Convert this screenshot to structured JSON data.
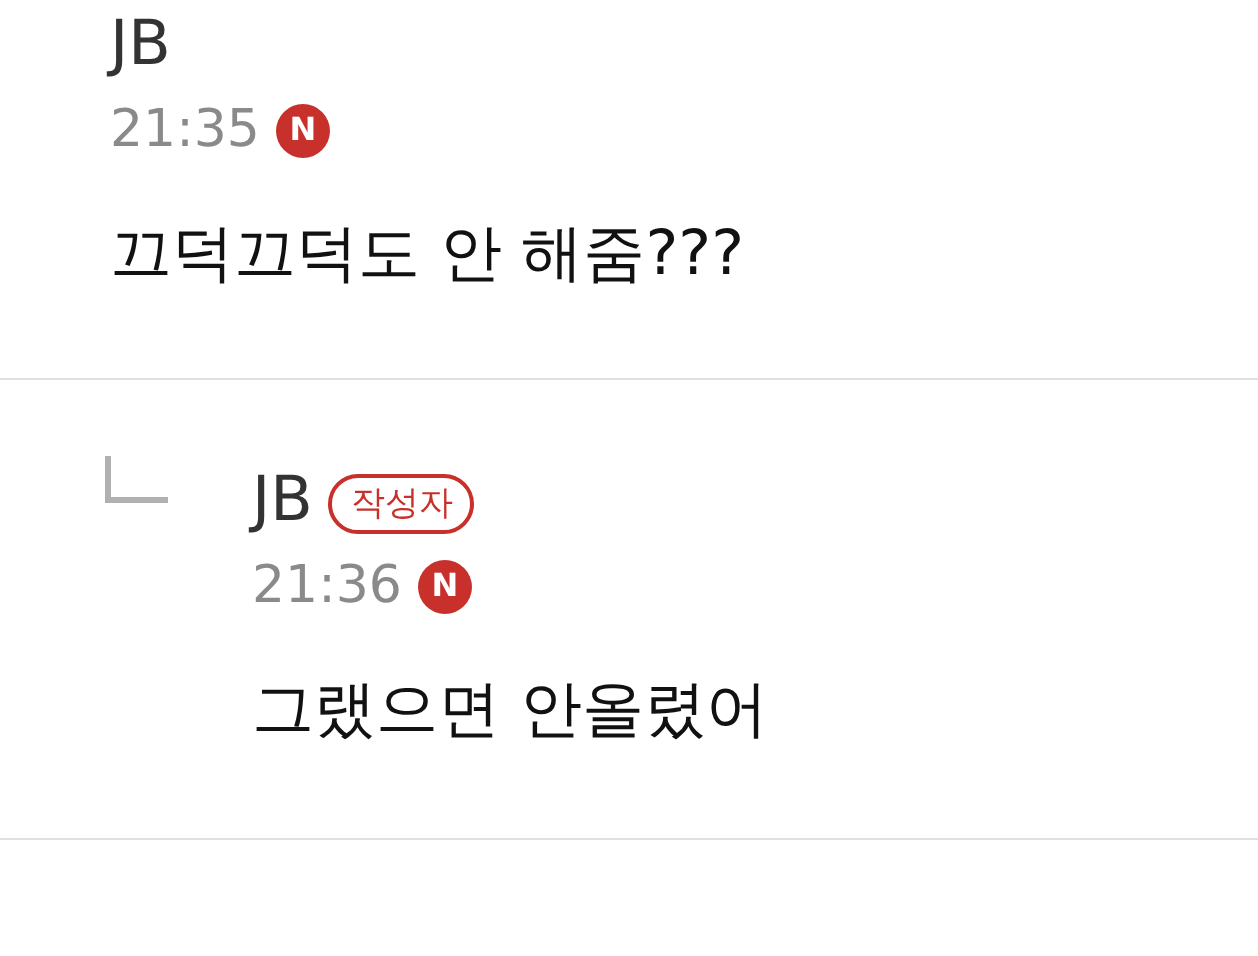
{
  "comments": [
    {
      "kind": "comment",
      "author": "JB",
      "time": "21:35",
      "new_mark": "N",
      "text": "끄덕끄덕도 안 해줌???"
    },
    {
      "kind": "reply",
      "author": "JB",
      "author_badge": "작성자",
      "time": "21:36",
      "new_mark": "N",
      "text": "그랬으면 안올렸어"
    }
  ]
}
